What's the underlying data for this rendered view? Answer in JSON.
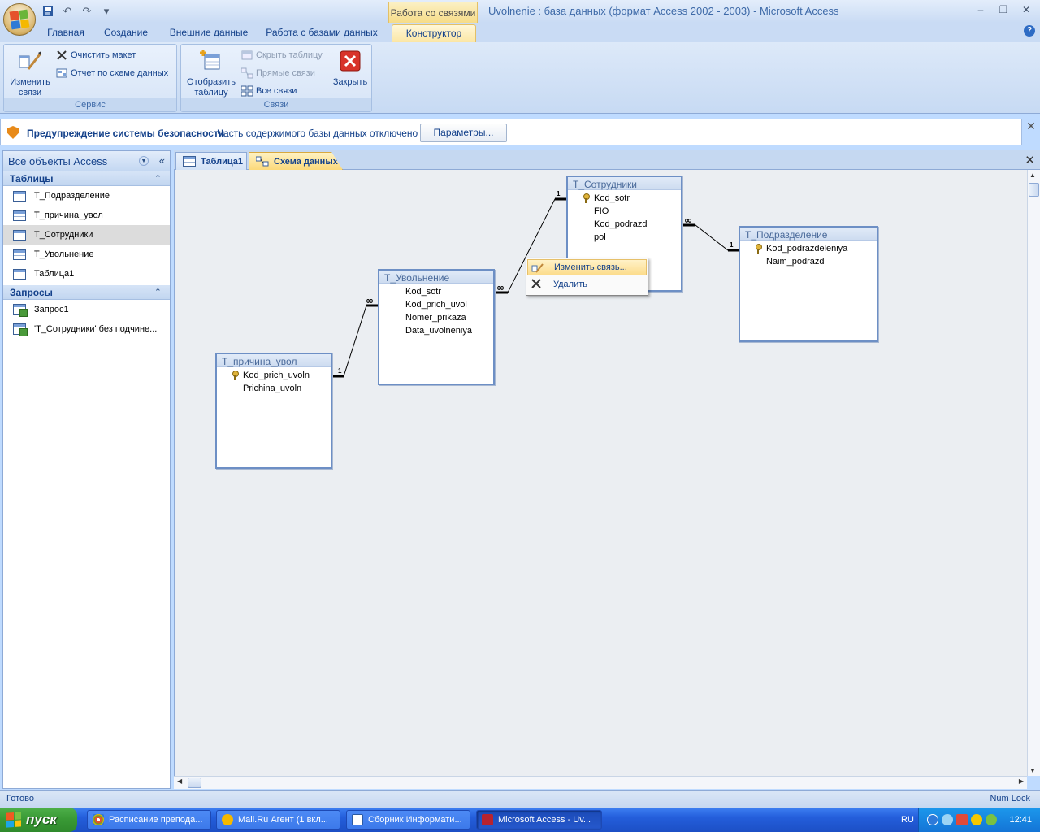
{
  "window": {
    "title": "Uvolnenie : база данных (формат Access 2002 - 2003) - Microsoft Access",
    "context_group": "Работа со связями",
    "controls": {
      "minimize": "–",
      "restore": "❐",
      "close": "✕"
    }
  },
  "qat": {
    "save_icon": "save-icon",
    "undo": "↶",
    "redo": "↷",
    "customize": "▾"
  },
  "ribbon": {
    "tabs": [
      "Главная",
      "Создание",
      "Внешние данные",
      "Работа с базами данных",
      "Конструктор"
    ],
    "active_tab": "Конструктор",
    "groups": {
      "service": {
        "label": "Сервис",
        "edit_links": "Изменить связи",
        "clear_layout": "Очистить макет",
        "schema_report": "Отчет по схеме данных"
      },
      "links": {
        "label": "Связи",
        "show_table": "Отобразить таблицу",
        "hide_table": "Скрыть таблицу",
        "direct_links": "Прямые связи",
        "all_links": "Все связи",
        "close": "Закрыть"
      }
    }
  },
  "security_bar": {
    "title": "Предупреждение системы безопасности",
    "message": "Часть содержимого базы данных отключено",
    "button": "Параметры..."
  },
  "nav": {
    "header": "Все объекты Access",
    "sections": [
      {
        "title": "Таблицы",
        "items": [
          "Т_Подразделение",
          "Т_причина_увол",
          "Т_Сотрудники",
          "Т_Увольнение",
          "Таблица1"
        ],
        "selected": 2
      },
      {
        "title": "Запросы",
        "items": [
          "Запрос1",
          "'Т_Сотрудники' без подчине..."
        ]
      }
    ]
  },
  "doc_tabs": [
    "Таблица1",
    "Схема данных"
  ],
  "active_doc_tab": "Схема данных",
  "schema": {
    "tables": [
      {
        "id": "t_sotr",
        "name": "Т_Сотрудники",
        "fields": [
          "Kod_sotr",
          "FIO",
          "Kod_podrazd",
          "pol"
        ],
        "key": 0
      },
      {
        "id": "t_podr",
        "name": "Т_Подразделение",
        "fields": [
          "Kod_podrazdeleniya",
          "Naim_podrazd"
        ],
        "key": 0
      },
      {
        "id": "t_uvol",
        "name": "Т_Увольнение",
        "fields": [
          "Kod_sotr",
          "Kod_prich_uvol",
          "Nomer_prikaza",
          "Data_uvolneniya"
        ],
        "key": -1
      },
      {
        "id": "t_prich",
        "name": "Т_причина_увол",
        "fields": [
          "Kod_prich_uvoln",
          "Prichina_uvoln"
        ],
        "key": 0
      }
    ],
    "relations": [
      {
        "from": "Т_причина_увол",
        "to": "Т_Увольнение",
        "one": "1",
        "many": "∞"
      },
      {
        "from": "Т_Сотрудники",
        "to": "Т_Увольнение",
        "one": "1",
        "many": "∞"
      },
      {
        "from": "Т_Подразделение",
        "to": "Т_Сотрудники",
        "one": "1",
        "many": "∞"
      }
    ]
  },
  "context_menu": {
    "items": [
      "Изменить связь...",
      "Удалить"
    ],
    "highlighted": 0
  },
  "status": {
    "left": "Готово",
    "right": "Num Lock"
  },
  "taskbar": {
    "start": "пуск",
    "tasks": [
      "Расписание препода...",
      "Mail.Ru Агент (1 вкл...",
      "Сборник Информати...",
      "Microsoft Access - Uv..."
    ],
    "active_task": 3,
    "lang": "RU",
    "time": "12:41"
  },
  "colors": {
    "ribbon_bg": "#c9dbf4",
    "context_tab": "#fbe6a4",
    "canvas": "#ebeef2",
    "taskbar": "#245edb",
    "start": "#3a9a36"
  }
}
